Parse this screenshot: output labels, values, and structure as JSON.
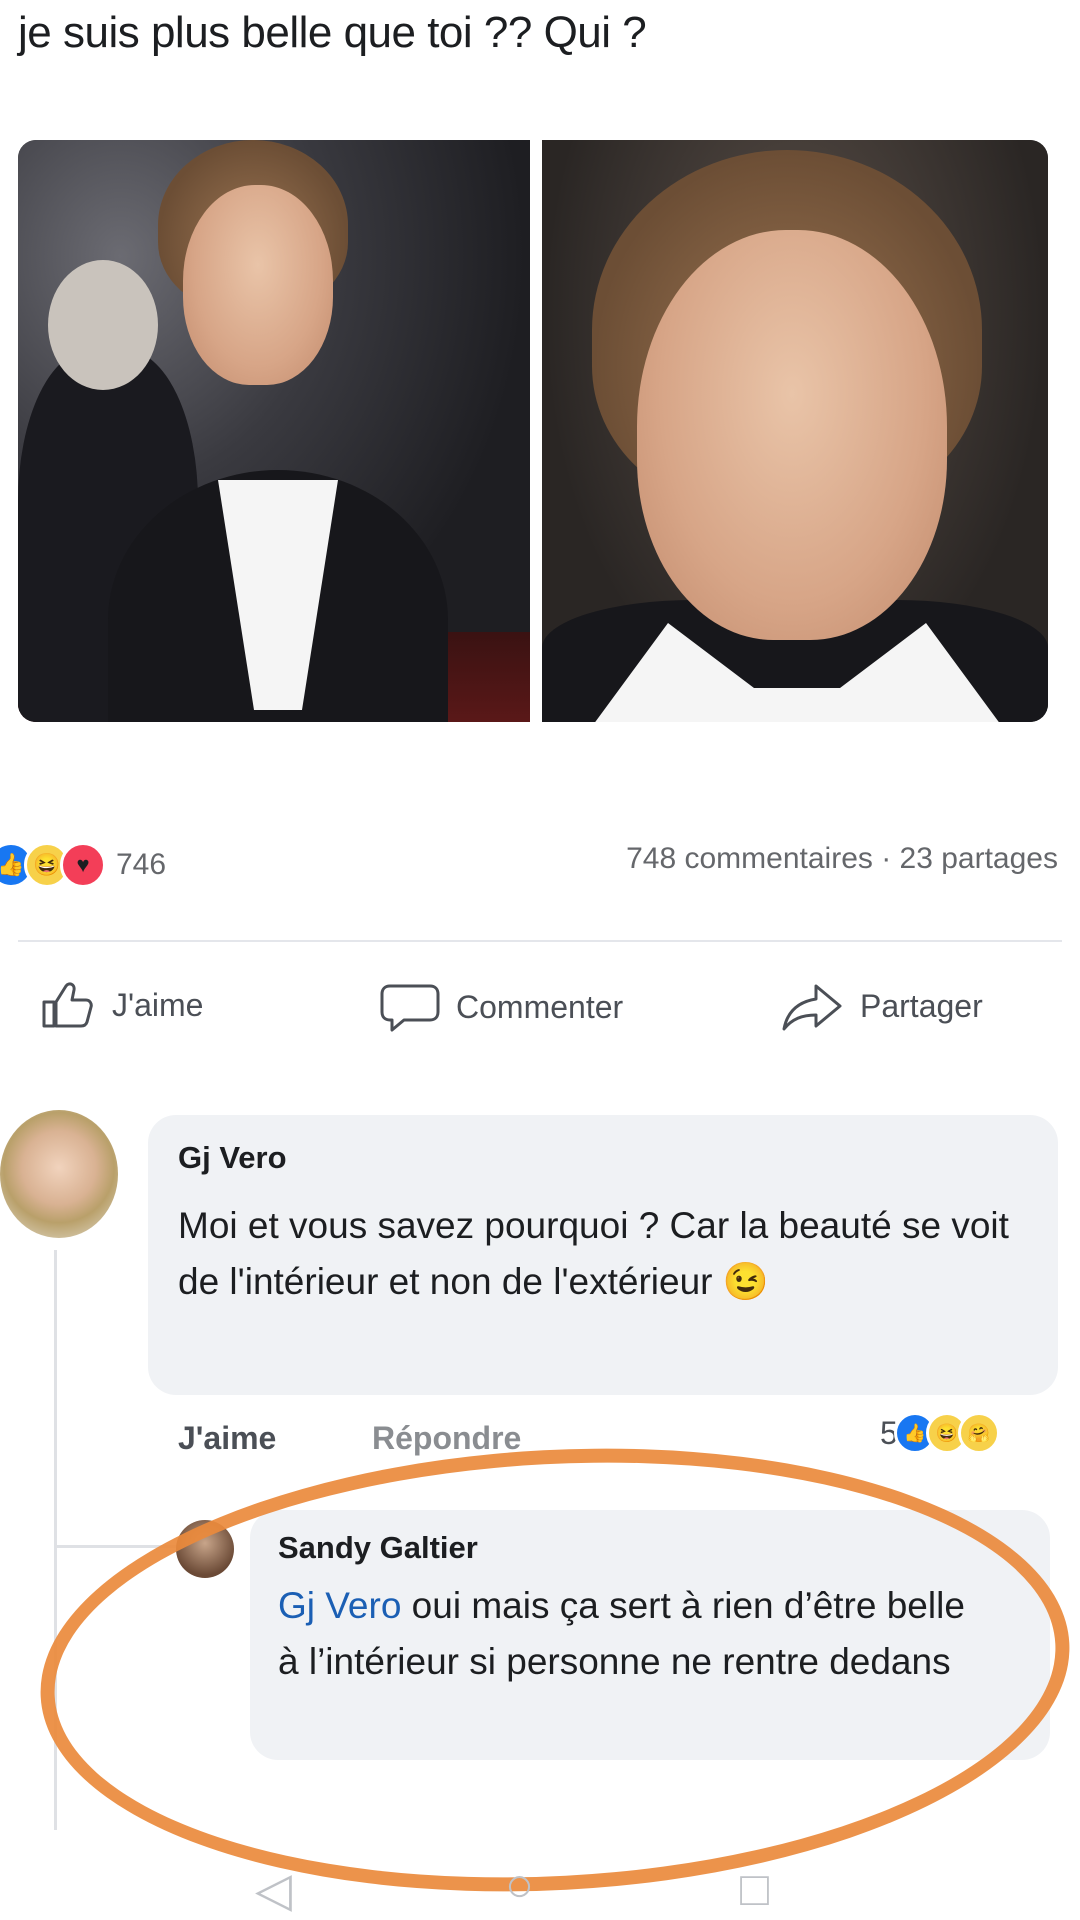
{
  "post": {
    "text": "je suis plus belle que toi ?? Qui ?"
  },
  "reactions": {
    "count": "746",
    "icons": [
      "like-icon",
      "haha-icon",
      "love-icon"
    ],
    "stats": "748 commentaires · 23 partages"
  },
  "actions": {
    "like": "J'aime",
    "comment": "Commenter",
    "share": "Partager"
  },
  "comments": [
    {
      "author": "Gj Vero",
      "text": "Moi et vous savez pourquoi ? Car la beauté se voit de l'intérieur et non de l'extérieur",
      "emoji": "😉",
      "like_label": "J'aime",
      "reply_label": "Répondre",
      "reaction_count": "5"
    },
    {
      "author": "Sandy Galtier",
      "mention": "Gj Vero",
      "text": " oui mais ça sert à rien d’être belle à l’intérieur si personne ne rentre dedans"
    }
  ],
  "colors": {
    "highlight_ring": "#ea8a3c",
    "like_blue": "#1877f2",
    "mention_blue": "#1b5fb4"
  }
}
